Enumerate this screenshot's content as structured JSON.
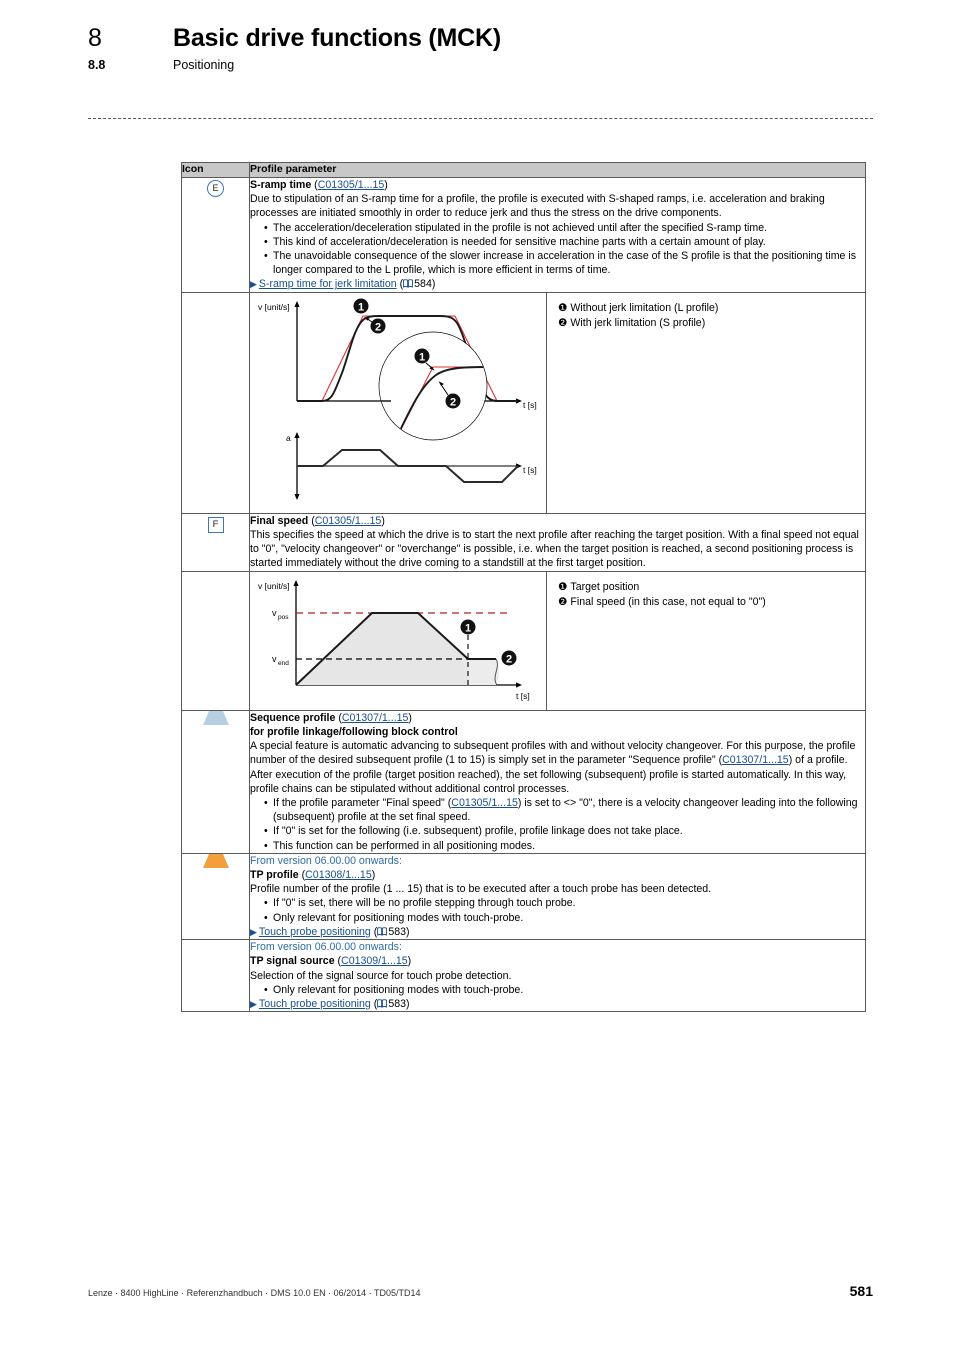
{
  "header": {
    "chapter_number": "8",
    "chapter_title": "Basic drive functions (MCK)",
    "section_number": "8.8",
    "section_title": "Positioning"
  },
  "table": {
    "headers": {
      "icon": "Icon",
      "parameter": "Profile parameter"
    }
  },
  "sections": {
    "sramp": {
      "icon_letter": "E",
      "title": "S-ramp time",
      "code": "C01305/1...15",
      "intro": "Due to stipulation of an S-ramp time for a profile, the profile is executed with S-shaped ramps, i.e. acceleration and braking processes are initiated smoothly in order to reduce jerk and thus the stress on the drive components.",
      "bullets": [
        "The acceleration/deceleration stipulated in the profile is not achieved until after the specified S-ramp time.",
        "This kind of acceleration/deceleration is needed for sensitive machine parts with a certain amount of play.",
        "The unavoidable consequence of the slower increase in acceleration in the case of the S profile is that the positioning time is longer compared to the L profile, which is more efficient in terms of time."
      ],
      "xref_text": "S-ramp time for jerk limitation",
      "xref_page": "584",
      "legend": [
        {
          "marker": "❶",
          "text": "Without jerk limitation (L profile)"
        },
        {
          "marker": "❷",
          "text": "With jerk limitation (S profile)"
        }
      ],
      "figure": {
        "y_axis_top": "v [unit/s]",
        "x_axis_top": "t [s]",
        "y_axis_bottom": "a",
        "x_axis_bottom": "t [s]",
        "callout_1": "❶",
        "callout_2": "❷"
      }
    },
    "final_speed": {
      "icon_letter": "F",
      "title": "Final speed",
      "code": "C01305/1...15",
      "body": "This specifies the speed at which the drive is to start the next profile after reaching the target position. With a final speed not equal to \"0\", \"velocity changeover\" or \"overchange\" is possible, i.e. when the target position is reached, a second positioning process is started immediately without the drive coming to a standstill at the first target position.",
      "legend": [
        {
          "marker": "❶",
          "text": "Target position"
        },
        {
          "marker": "❷",
          "text": "Final speed (in this case, not equal to \"0\")"
        }
      ],
      "figure": {
        "y_axis": "v [unit/s]",
        "x_axis": "t [s]",
        "label_vpos": "v",
        "label_vpos_sub": "pos",
        "label_vend": "v",
        "label_vend_sub": "end",
        "callout_1": "❶",
        "callout_2": "❷"
      }
    },
    "sequence_profile": {
      "icon": "trapezoid-blue",
      "icon_color": "#b7cfe3",
      "title": "Sequence profile",
      "code": "C01307/1...15",
      "subtitle": "for profile linkage/following block control",
      "para1_a": "A special feature is automatic advancing to subsequent profiles with and without velocity changeover. For this purpose, the profile number of the desired subsequent profile (1 to 15) is simply set in the parameter \"Sequence profile\" (",
      "para1_code": "C01307/1...15",
      "para1_b": ") of a profile.",
      "para2": "After execution of the profile (target position reached), the set following (subsequent) profile is started automatically. In this way, profile chains can be stipulated without additional control processes.",
      "bullet1_a": "If the profile parameter \"Final speed\" (",
      "bullet1_code": "C01305/1...15",
      "bullet1_b": ") is set to <> \"0\", there is a velocity changeover leading into the following (subsequent) profile at the set final speed.",
      "bullets_rest": [
        "If \"0\" is set for the following (i.e. subsequent) profile, profile linkage does not take place.",
        "This function can be performed in all positioning modes."
      ]
    },
    "tp_profile": {
      "icon": "trapezoid-orange",
      "icon_color": "#f2a03c",
      "version_note": "From version 06.00.00 onwards:",
      "title": "TP profile",
      "code": "C01308/1...15",
      "body": "Profile number of the profile (1 ... 15) that is to be executed after a touch probe has been detected.",
      "bullets": [
        "If \"0\" is set, there will be no profile stepping through touch probe.",
        "Only relevant for positioning modes with touch-probe."
      ],
      "xref_text": "Touch probe positioning",
      "xref_page": "583"
    },
    "tp_signal_source": {
      "version_note": "From version 06.00.00 onwards:",
      "title": "TP signal source",
      "code": "C01309/1...15",
      "body": "Selection of the signal source for touch probe detection.",
      "bullets": [
        "Only relevant for positioning modes with touch-probe."
      ],
      "xref_text": "Touch probe positioning",
      "xref_page": "583"
    }
  },
  "footer": {
    "left": "Lenze · 8400 HighLine · Referenzhandbuch · DMS 10.0 EN · 06/2014 · TD05/TD14",
    "page": "581"
  }
}
